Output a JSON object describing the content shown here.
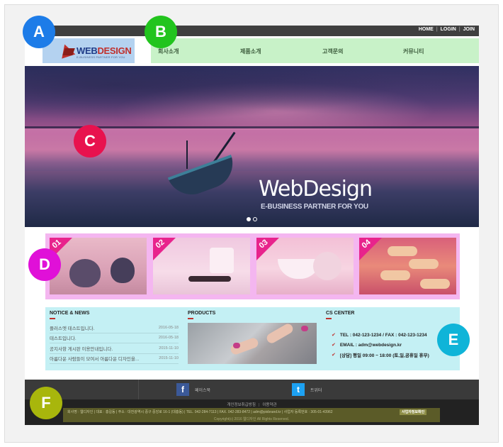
{
  "top_links": [
    "HOME",
    "LOGIN",
    "JOIN"
  ],
  "logo": {
    "brand_web": "WEB",
    "brand_design": "DESIGN",
    "tagline": "E-BUSINESS PARTNER FOR YOU"
  },
  "nav": [
    "회사소개",
    "제품소개",
    "고객문의",
    "커뮤니티"
  ],
  "hero": {
    "title": "WebDesign",
    "subtitle": "E-BUSINESS PARTNER FOR YOU",
    "slide_count": 2,
    "active_slide": 1
  },
  "gallery": [
    {
      "num": "01"
    },
    {
      "num": "02"
    },
    {
      "num": "03"
    },
    {
      "num": "04"
    }
  ],
  "notice": {
    "title": "NOTICE & NEWS",
    "items": [
      {
        "text": "플러스엣 테스트입니다.",
        "date": "2016-05-18"
      },
      {
        "text": "테스트입니다.",
        "date": "2016-05-18"
      },
      {
        "text": "공지사항 게시판 이용안내입니다.",
        "date": "2015-11-10"
      },
      {
        "text": "아름다운 사람들이 모여서 아름다운 디자인을...",
        "date": "2015-11-10"
      }
    ]
  },
  "products": {
    "title": "PRODUCTS"
  },
  "cs": {
    "title": "CS CENTER",
    "lines": [
      "TEL : 042-123-1234 / FAX : 042-123-1234",
      "EMAIL : adm@webdesign.kr",
      "[상담] 평일 09:00 ~ 18:00 (토,일,공휴일 휴무)"
    ]
  },
  "footer": {
    "social": [
      {
        "icon": "f",
        "label": "페이스북"
      },
      {
        "icon": "t",
        "label": "트위터"
      }
    ],
    "links": [
      "개인정보취급방침",
      "이용약관"
    ],
    "info": "회사명 : 웹디자인  |  대표 : 홍길동  |  주소 : 대전광역시 중구 중앙로 16-1 (대흥동)  |  TEL. 042-284-7113  |  FAX. 042-283-8472  |  adm@pixbrand.kr  |  사업자 등록번호 : 305-01-43962",
    "info_button": "사업자정보확인",
    "copyright": "Copyright(c) 2016 웹디자인 All Rights Reserved."
  },
  "labels": [
    {
      "letter": "A",
      "color": "#1d7ce8"
    },
    {
      "letter": "B",
      "color": "#22c41e"
    },
    {
      "letter": "C",
      "color": "#e8124e"
    },
    {
      "letter": "D",
      "color": "#e010d8"
    },
    {
      "letter": "E",
      "color": "#0fb4d8"
    },
    {
      "letter": "F",
      "color": "#a8b60c"
    }
  ]
}
